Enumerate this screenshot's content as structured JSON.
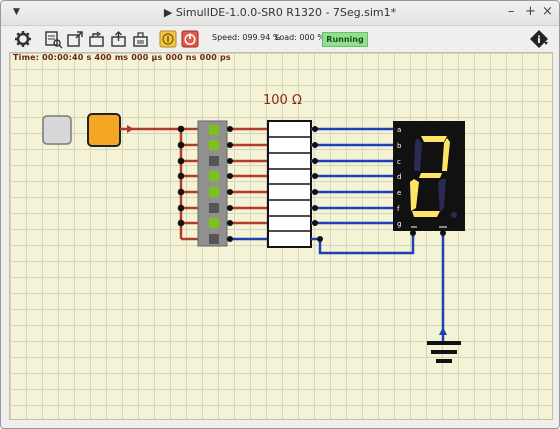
{
  "window": {
    "title": "▶ SimulIDE-1.0.0-SR0 R1320 - 7Seg.sim1*",
    "controls": [
      "–",
      "+",
      "×"
    ]
  },
  "toolbar": {
    "speed": "Speed: 099.94 %",
    "load": "Load: 000 %",
    "status": "Running",
    "icons": [
      "gear-icon",
      "circuit-icon",
      "new-file-icon",
      "open-icon",
      "save-icon",
      "save-as-icon",
      "pause-icon",
      "power-icon",
      "info-icon"
    ]
  },
  "time": "Time: 00:00:40 s   400 ms   000 µs   000 ns   000 ps",
  "resistor_label": "100 Ω",
  "segment_labels": [
    "a",
    "b",
    "c",
    "d",
    "e",
    "f",
    "g"
  ],
  "colors": {
    "running": "#8fe08f",
    "switch_on": "#f5a623",
    "wire_red": "#b43a2a",
    "wire_blue": "#1f3fb4",
    "segment_on": "#ffe46a",
    "led_on": "#7cc21a"
  }
}
